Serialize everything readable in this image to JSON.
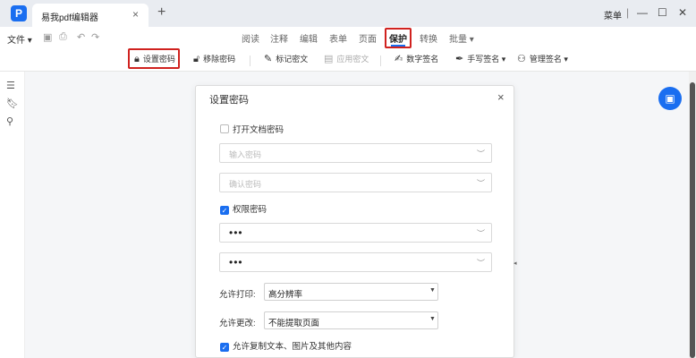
{
  "window": {
    "app_logo_glyph": "P",
    "tab_title": "易我pdf编辑器",
    "tab_close": "×",
    "tab_add": "+",
    "menu_label": "菜单",
    "minimize": "—",
    "maximize": "☐",
    "close": "✕"
  },
  "menubar": {
    "file_menu": "文件 ▾",
    "nav_tabs": [
      "阅读",
      "注释",
      "编辑",
      "表单",
      "页面",
      "保护",
      "转换",
      "批量 ▾"
    ],
    "active_tab": "保护"
  },
  "toolbar": {
    "set_password": "设置密码",
    "remove_password": "移除密码",
    "mark_redaction": "标记密文",
    "apply_redaction": "应用密文",
    "digital_signature": "数字签名",
    "handwritten_signature": "手写签名 ▾",
    "manage_signatures": "管理签名 ▾"
  },
  "dialog": {
    "title": "设置密码",
    "close": "×",
    "open_doc_password_label": "打开文档密码",
    "open_doc_password_checked": false,
    "enter_password_placeholder": "输入密码",
    "confirm_password_placeholder": "确认密码",
    "permission_password_label": "权限密码",
    "permission_password_checked": true,
    "permission_password_value": "•••",
    "permission_confirm_value": "•••",
    "allow_print_label": "允许打印:",
    "allow_print_value": "高分辨率",
    "allow_change_label": "允许更改:",
    "allow_change_value": "不能提取页面",
    "allow_copy_label": "允许复制文本、图片及其他内容",
    "allow_copy_checked": true
  },
  "colors": {
    "accent": "#1a6ef0",
    "highlight": "#d0221f"
  }
}
